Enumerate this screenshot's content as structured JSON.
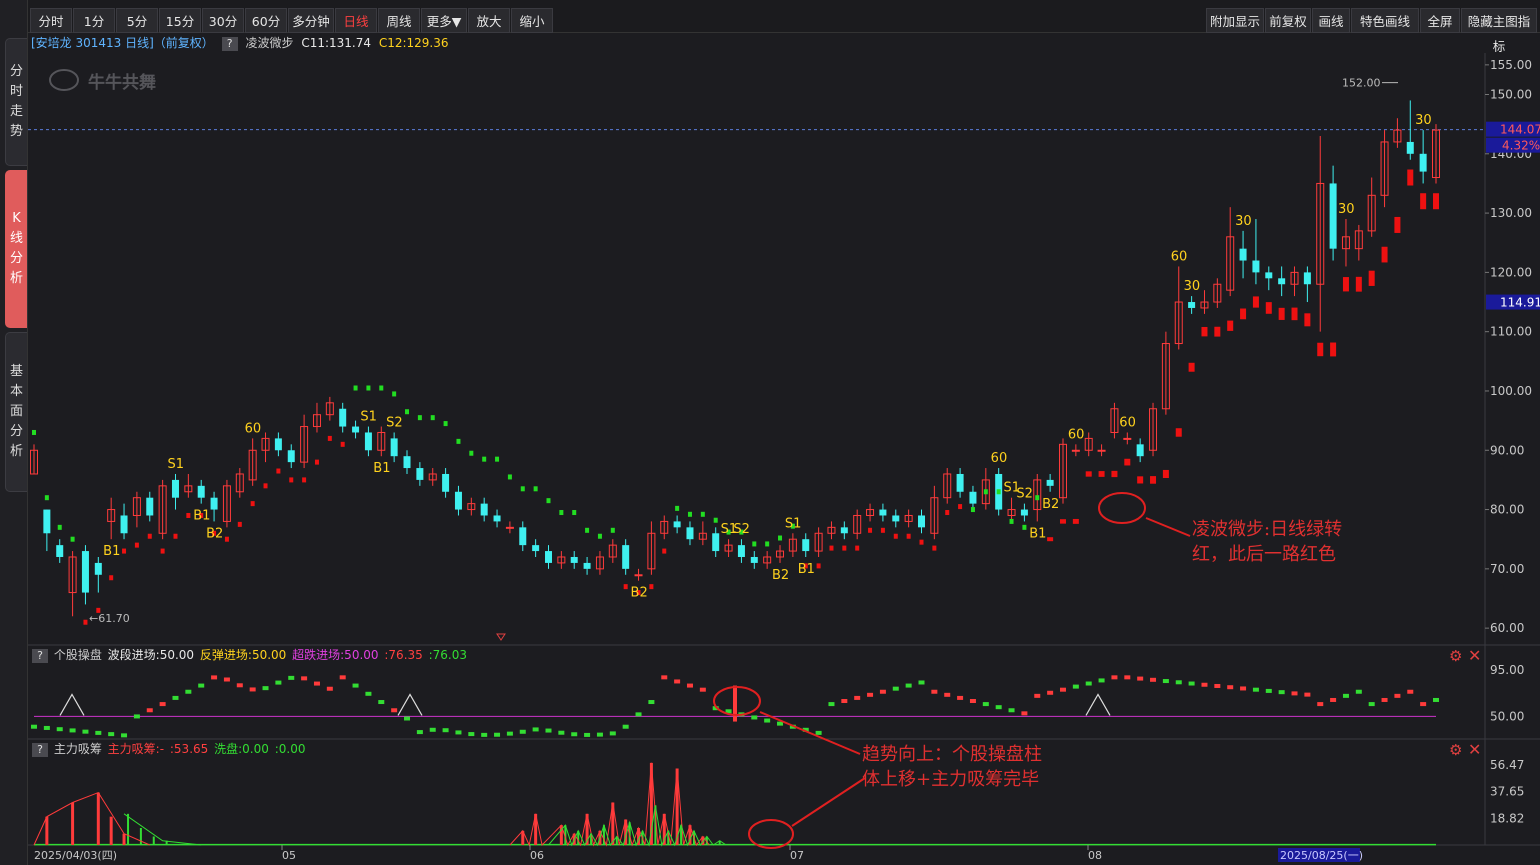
{
  "sidebar": {
    "tabs": [
      {
        "label": "分时走势",
        "chars": [
          "分",
          "时",
          "走",
          "势"
        ],
        "active": false
      },
      {
        "label": "K线分析",
        "chars": [
          "K",
          "线",
          "分",
          "析"
        ],
        "active": true
      },
      {
        "label": "基本面分析",
        "chars": [
          "基",
          "本",
          "面",
          "分",
          "析"
        ],
        "active": false
      }
    ]
  },
  "toolbar": {
    "left": [
      {
        "label": "分时",
        "active": false
      },
      {
        "label": "1分",
        "active": false
      },
      {
        "label": "5分",
        "active": false
      },
      {
        "label": "15分",
        "active": false
      },
      {
        "label": "30分",
        "active": false
      },
      {
        "label": "60分",
        "active": false
      },
      {
        "label": "多分钟",
        "active": false
      },
      {
        "label": "日线",
        "active": true
      },
      {
        "label": "周线",
        "active": false
      },
      {
        "label": "更多▼",
        "active": false
      },
      {
        "label": "放大",
        "active": false
      },
      {
        "label": "缩小",
        "active": false
      }
    ],
    "right": [
      {
        "label": "附加显示"
      },
      {
        "label": "前复权"
      },
      {
        "label": "画线"
      },
      {
        "label": "特色画线"
      },
      {
        "label": "全屏"
      },
      {
        "label": "隐藏主图指标"
      }
    ]
  },
  "main_panel": {
    "title": "[安培龙 301413 日线]（前复权）",
    "help": "?",
    "indicator": "凌波微步",
    "c11_label": "C11:131.74",
    "c12_label": "C12:129.36",
    "watermark": "牛牛共舞",
    "price_axis": [
      "155.00",
      "150.00",
      "140.00",
      "130.00",
      "120.00",
      "110.00",
      "100.00",
      "90.00",
      "80.00",
      "70.00",
      "60.00"
    ],
    "current_price": "144.07",
    "change_pct": "4.32%",
    "crosshair_price": "114.91",
    "high_label": "152.00",
    "low_label": "61.70"
  },
  "panel2": {
    "help": "?",
    "name": "个股操盘",
    "v1": "波段进场:50.00",
    "v2": "反弹进场:50.00",
    "v3": "超跌进场:50.00",
    "v4": ":76.35",
    "v5": ":76.03",
    "axis": [
      "95.00",
      "50.00"
    ]
  },
  "panel3": {
    "help": "?",
    "name": "主力吸筹",
    "v1": "主力吸筹:-",
    "v2": ":53.65",
    "v3": "洗盘:0.00",
    "v4": ":0.00",
    "axis": [
      "56.47",
      "37.65",
      "18.82"
    ]
  },
  "date_axis": {
    "start": "2025/04/03(四)",
    "months": [
      "05",
      "06",
      "07",
      "08"
    ],
    "cursor": "2025/08/25(一)"
  },
  "annotations": {
    "a1_line1": "凌波微步:日线绿转",
    "a1_line2": "红，此后一路红色",
    "a2_line1": "趋势向上：个股操盘柱",
    "a2_line2": "体上移+主力吸筹完毕"
  },
  "colors": {
    "up": "#ff3b3b",
    "down": "#3ff0f0",
    "bull_dot": "#ee1111",
    "bear_dot": "#22dd22",
    "label_yellow": "#ffd21e",
    "purple": "#cc33cc",
    "green": "#33dd33"
  },
  "chart_data": {
    "type": "candlestick",
    "price_range": [
      58,
      157
    ],
    "candles": [
      {
        "o": 86,
        "c": 90,
        "h": 91,
        "l": 86
      },
      {
        "o": 80,
        "c": 76,
        "h": 80,
        "l": 73
      },
      {
        "o": 74,
        "c": 72,
        "h": 75,
        "l": 71
      },
      {
        "o": 66,
        "c": 72,
        "h": 73,
        "l": 62
      },
      {
        "o": 73,
        "c": 66,
        "h": 74,
        "l": 64
      },
      {
        "o": 71,
        "c": 69,
        "h": 72,
        "l": 66
      },
      {
        "o": 78,
        "c": 80,
        "h": 82,
        "l": 75
      },
      {
        "o": 79,
        "c": 76,
        "h": 81,
        "l": 75
      },
      {
        "o": 79,
        "c": 82,
        "h": 83,
        "l": 77
      },
      {
        "o": 82,
        "c": 79,
        "h": 83,
        "l": 78
      },
      {
        "o": 76,
        "c": 84,
        "h": 85,
        "l": 75
      },
      {
        "o": 85,
        "c": 82,
        "h": 86,
        "l": 80
      },
      {
        "o": 83,
        "c": 84,
        "h": 86,
        "l": 82
      },
      {
        "o": 84,
        "c": 82,
        "h": 85,
        "l": 81
      },
      {
        "o": 82,
        "c": 80,
        "h": 83,
        "l": 78
      },
      {
        "o": 78,
        "c": 84,
        "h": 85,
        "l": 77
      },
      {
        "o": 83,
        "c": 86,
        "h": 87,
        "l": 82
      },
      {
        "o": 85,
        "c": 90,
        "h": 92,
        "l": 84
      },
      {
        "o": 90,
        "c": 92,
        "h": 93,
        "l": 88
      },
      {
        "o": 92,
        "c": 90,
        "h": 93,
        "l": 89
      },
      {
        "o": 90,
        "c": 88,
        "h": 91,
        "l": 87
      },
      {
        "o": 88,
        "c": 94,
        "h": 96,
        "l": 87
      },
      {
        "o": 94,
        "c": 96,
        "h": 98,
        "l": 93
      },
      {
        "o": 96,
        "c": 98,
        "h": 99,
        "l": 95
      },
      {
        "o": 97,
        "c": 94,
        "h": 98,
        "l": 93
      },
      {
        "o": 94,
        "c": 93,
        "h": 95,
        "l": 92
      },
      {
        "o": 93,
        "c": 90,
        "h": 94,
        "l": 89
      },
      {
        "o": 90,
        "c": 93,
        "h": 94,
        "l": 89
      },
      {
        "o": 92,
        "c": 89,
        "h": 93,
        "l": 88
      },
      {
        "o": 89,
        "c": 87,
        "h": 90,
        "l": 86
      },
      {
        "o": 87,
        "c": 85,
        "h": 88,
        "l": 84
      },
      {
        "o": 85,
        "c": 86,
        "h": 87,
        "l": 84
      },
      {
        "o": 86,
        "c": 83,
        "h": 87,
        "l": 82
      },
      {
        "o": 83,
        "c": 80,
        "h": 84,
        "l": 79
      },
      {
        "o": 80,
        "c": 81,
        "h": 82,
        "l": 79
      },
      {
        "o": 81,
        "c": 79,
        "h": 82,
        "l": 78
      },
      {
        "o": 79,
        "c": 78,
        "h": 80,
        "l": 77
      },
      {
        "o": 77,
        "c": 77,
        "h": 78,
        "l": 76
      },
      {
        "o": 77,
        "c": 74,
        "h": 78,
        "l": 73
      },
      {
        "o": 74,
        "c": 73,
        "h": 75,
        "l": 72
      },
      {
        "o": 73,
        "c": 71,
        "h": 74,
        "l": 70
      },
      {
        "o": 71,
        "c": 72,
        "h": 73,
        "l": 70
      },
      {
        "o": 72,
        "c": 71,
        "h": 73,
        "l": 70
      },
      {
        "o": 71,
        "c": 70,
        "h": 72,
        "l": 69
      },
      {
        "o": 70,
        "c": 72,
        "h": 73,
        "l": 69
      },
      {
        "o": 72,
        "c": 74,
        "h": 75,
        "l": 71
      },
      {
        "o": 74,
        "c": 70,
        "h": 75,
        "l": 69
      },
      {
        "o": 69,
        "c": 69,
        "h": 70,
        "l": 68
      },
      {
        "o": 70,
        "c": 76,
        "h": 78,
        "l": 69
      },
      {
        "o": 76,
        "c": 78,
        "h": 79,
        "l": 75
      },
      {
        "o": 78,
        "c": 77,
        "h": 79,
        "l": 76
      },
      {
        "o": 77,
        "c": 75,
        "h": 78,
        "l": 74
      },
      {
        "o": 75,
        "c": 76,
        "h": 78,
        "l": 74
      },
      {
        "o": 76,
        "c": 73,
        "h": 77,
        "l": 72
      },
      {
        "o": 73,
        "c": 74,
        "h": 75,
        "l": 72
      },
      {
        "o": 74,
        "c": 72,
        "h": 75,
        "l": 71
      },
      {
        "o": 72,
        "c": 71,
        "h": 73,
        "l": 70
      },
      {
        "o": 71,
        "c": 72,
        "h": 73,
        "l": 70
      },
      {
        "o": 72,
        "c": 73,
        "h": 74,
        "l": 71
      },
      {
        "o": 73,
        "c": 75,
        "h": 76,
        "l": 72
      },
      {
        "o": 75,
        "c": 73,
        "h": 76,
        "l": 72
      },
      {
        "o": 73,
        "c": 76,
        "h": 77,
        "l": 72
      },
      {
        "o": 76,
        "c": 77,
        "h": 78,
        "l": 75
      },
      {
        "o": 77,
        "c": 76,
        "h": 78,
        "l": 75
      },
      {
        "o": 76,
        "c": 79,
        "h": 80,
        "l": 75
      },
      {
        "o": 79,
        "c": 80,
        "h": 81,
        "l": 78
      },
      {
        "o": 80,
        "c": 79,
        "h": 81,
        "l": 78
      },
      {
        "o": 79,
        "c": 78,
        "h": 80,
        "l": 77
      },
      {
        "o": 78,
        "c": 79,
        "h": 80,
        "l": 77
      },
      {
        "o": 79,
        "c": 77,
        "h": 80,
        "l": 76
      },
      {
        "o": 76,
        "c": 82,
        "h": 84,
        "l": 75
      },
      {
        "o": 82,
        "c": 86,
        "h": 87,
        "l": 81
      },
      {
        "o": 86,
        "c": 83,
        "h": 87,
        "l": 82
      },
      {
        "o": 83,
        "c": 81,
        "h": 84,
        "l": 80
      },
      {
        "o": 81,
        "c": 85,
        "h": 87,
        "l": 80
      },
      {
        "o": 86,
        "c": 80,
        "h": 87,
        "l": 79
      },
      {
        "o": 79,
        "c": 80,
        "h": 82,
        "l": 78
      },
      {
        "o": 80,
        "c": 79,
        "h": 81,
        "l": 78
      },
      {
        "o": 80,
        "c": 85,
        "h": 86,
        "l": 78
      },
      {
        "o": 85,
        "c": 84,
        "h": 86,
        "l": 83
      },
      {
        "o": 82,
        "c": 91,
        "h": 92,
        "l": 81
      },
      {
        "o": 90,
        "c": 90,
        "h": 91,
        "l": 89
      },
      {
        "o": 90,
        "c": 92,
        "h": 93,
        "l": 89
      },
      {
        "o": 90,
        "c": 90,
        "h": 91,
        "l": 89
      },
      {
        "o": 93,
        "c": 97,
        "h": 98,
        "l": 92
      },
      {
        "o": 92,
        "c": 92,
        "h": 93,
        "l": 91
      },
      {
        "o": 91,
        "c": 89,
        "h": 92,
        "l": 88
      },
      {
        "o": 90,
        "c": 97,
        "h": 98,
        "l": 89
      },
      {
        "o": 97,
        "c": 108,
        "h": 110,
        "l": 96
      },
      {
        "o": 108,
        "c": 115,
        "h": 121,
        "l": 107
      },
      {
        "o": 115,
        "c": 114,
        "h": 116,
        "l": 113
      },
      {
        "o": 114,
        "c": 115,
        "h": 117,
        "l": 113
      },
      {
        "o": 115,
        "c": 118,
        "h": 119,
        "l": 114
      },
      {
        "o": 117,
        "c": 126,
        "h": 131,
        "l": 116
      },
      {
        "o": 124,
        "c": 122,
        "h": 127,
        "l": 119
      },
      {
        "o": 122,
        "c": 120,
        "h": 129,
        "l": 118
      },
      {
        "o": 120,
        "c": 119,
        "h": 121,
        "l": 117
      },
      {
        "o": 119,
        "c": 118,
        "h": 121,
        "l": 116
      },
      {
        "o": 118,
        "c": 120,
        "h": 121,
        "l": 116
      },
      {
        "o": 120,
        "c": 118,
        "h": 121,
        "l": 115
      },
      {
        "o": 118,
        "c": 135,
        "h": 143,
        "l": 110
      },
      {
        "o": 135,
        "c": 124,
        "h": 138,
        "l": 122
      },
      {
        "o": 124,
        "c": 126,
        "h": 129,
        "l": 121
      },
      {
        "o": 124,
        "c": 127,
        "h": 128,
        "l": 122
      },
      {
        "o": 127,
        "c": 133,
        "h": 136,
        "l": 126
      },
      {
        "o": 133,
        "c": 142,
        "h": 144,
        "l": 131
      },
      {
        "o": 142,
        "c": 144,
        "h": 146,
        "l": 141
      },
      {
        "o": 142,
        "c": 140,
        "h": 149,
        "l": 139
      },
      {
        "o": 140,
        "c": 137,
        "h": 144,
        "l": 135
      },
      {
        "o": 136,
        "c": 144,
        "h": 145,
        "l": 135
      }
    ],
    "signal_dots": "trailing stop dots: green while bearish until early Aug, then red to the end",
    "indicator_panel2": {
      "lines": [
        50
      ],
      "range": [
        30,
        100
      ]
    },
    "indicator_panel3": {
      "range": [
        0,
        60
      ]
    }
  }
}
